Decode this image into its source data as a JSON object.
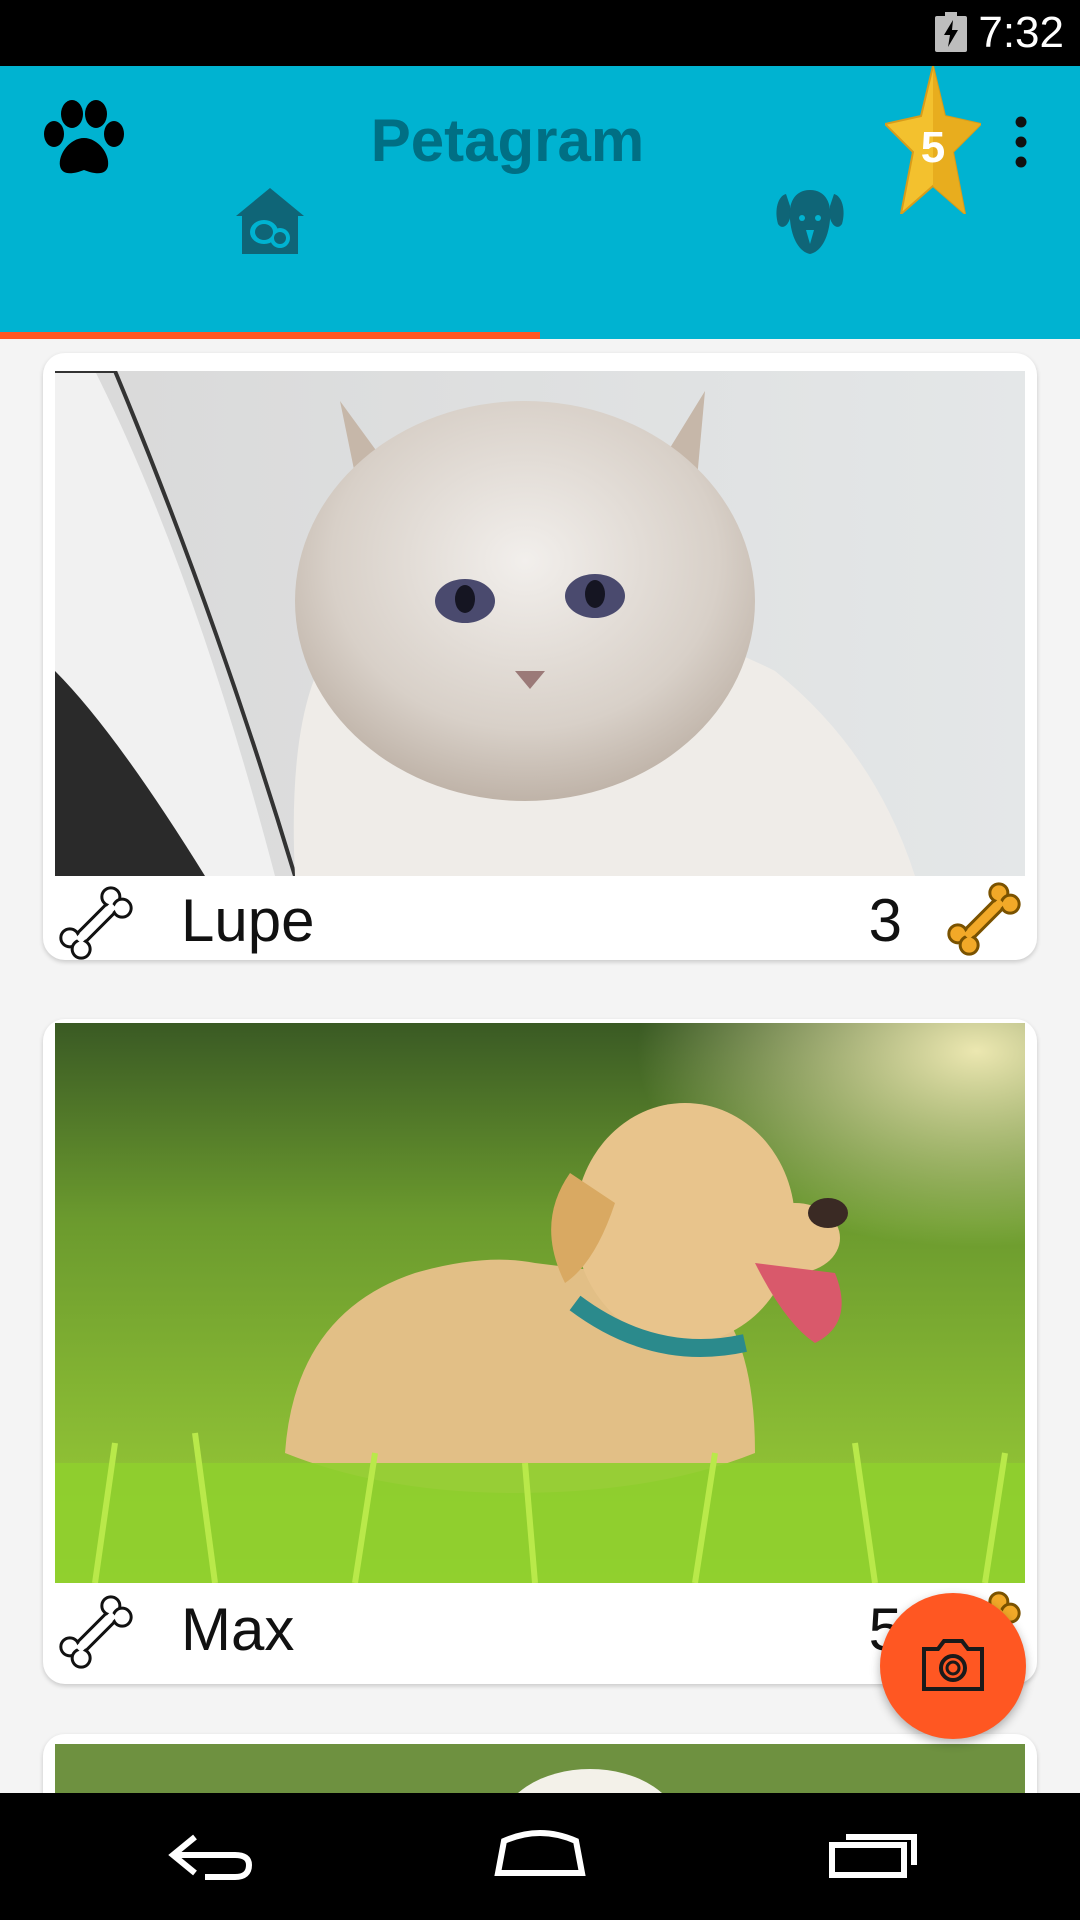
{
  "status_bar": {
    "time": "7:32",
    "battery_icon": "battery-charging-icon"
  },
  "app_bar": {
    "title": "Petagram",
    "logo_icon": "paw-icon",
    "favorites_icon": "star-five-icon",
    "favorites_badge": "5",
    "overflow_icon": "more-vert-icon"
  },
  "tabs": [
    {
      "name": "home",
      "icon": "house-pet-icon",
      "selected": true
    },
    {
      "name": "profile",
      "icon": "dog-face-icon",
      "selected": false
    }
  ],
  "colors": {
    "app_bar": "#00b3d1",
    "title": "#006f84",
    "accent": "#ff5722",
    "bone_filled": "#f2a928",
    "star": "#f3c12e"
  },
  "pets": [
    {
      "name": "Lupe",
      "likes": "3",
      "photo": "white fluffy cat"
    },
    {
      "name": "Max",
      "likes": "5",
      "photo": "golden dog lying in grass"
    },
    {
      "name": "",
      "likes": "",
      "photo": "white dog in grass (partially visible)"
    }
  ],
  "fab": {
    "icon": "camera-icon"
  },
  "nav": {
    "back_icon": "back-icon",
    "home_icon": "home-icon",
    "recents_icon": "recents-icon"
  }
}
